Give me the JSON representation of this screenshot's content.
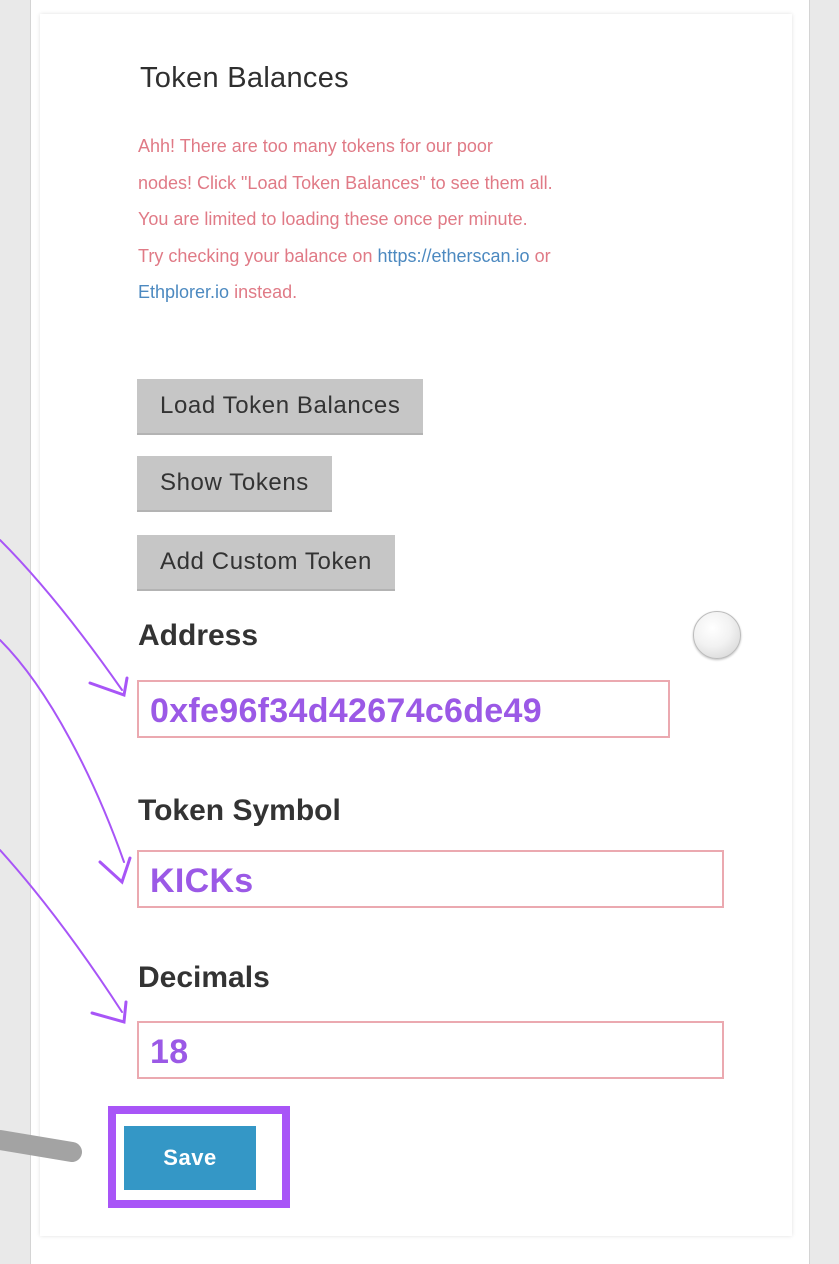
{
  "panel": {
    "title": "Token Balances",
    "warning_lines": [
      "Ahh! There are too many tokens for our poor",
      "nodes! Click \"Load Token Balances\" to see them all.",
      "You are limited to loading these once per minute.",
      "Try checking your balance on ",
      "or",
      "instead."
    ],
    "links": [
      "https://etherscan.io",
      "Ethplorer.io"
    ]
  },
  "buttons": {
    "load": "Load Token Balances",
    "show": "Show Tokens",
    "add_custom": "Add Custom Token",
    "save": "Save"
  },
  "form": {
    "address_label": "Address",
    "address_value": "0xfe96f34d42674c6de49",
    "symbol_label": "Token Symbol",
    "symbol_value": "KICKs",
    "decimals_label": "Decimals",
    "decimals_value": "18"
  },
  "colors": {
    "warning_text": "#e07a86",
    "link": "#4c89c0",
    "annotation": "#a855f7",
    "save_button": "#3497c6",
    "field_border": "#eba9b0"
  }
}
